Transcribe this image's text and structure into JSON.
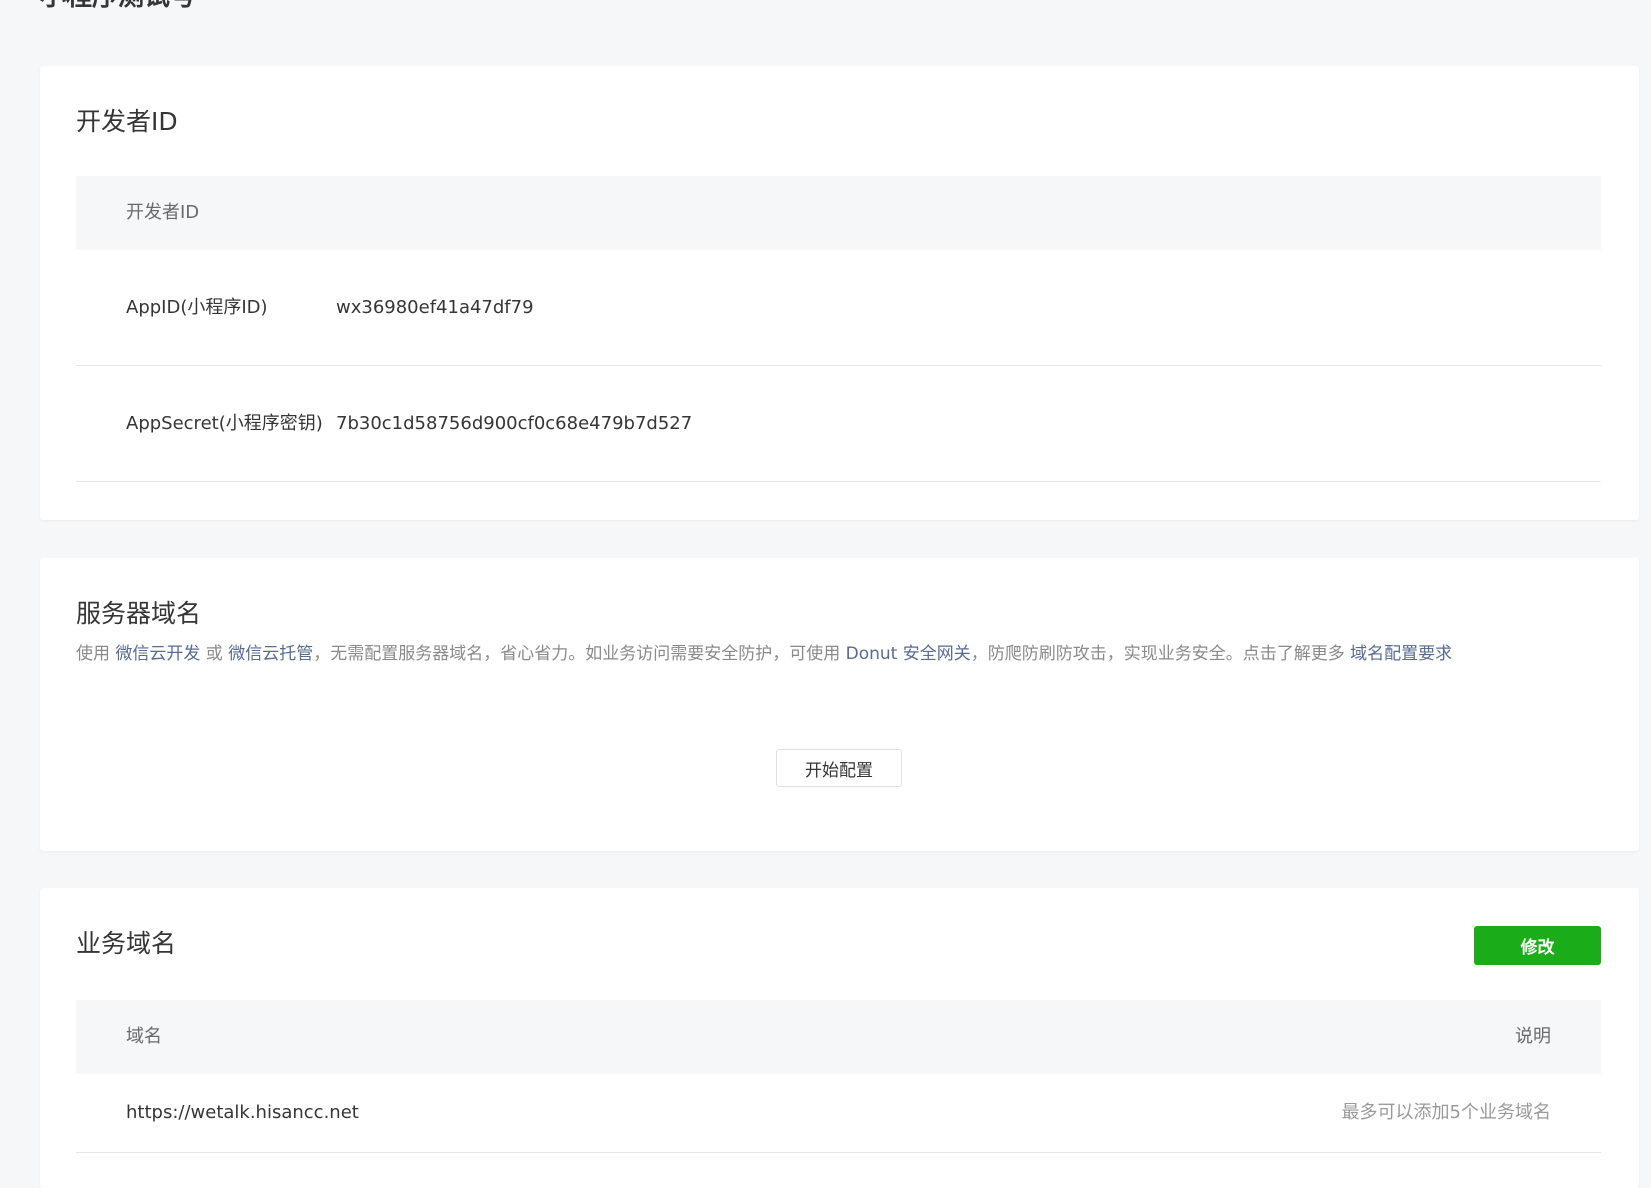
{
  "page": {
    "title": "小程序测试号"
  },
  "developer_id": {
    "title": "开发者ID",
    "table_header": "开发者ID",
    "rows": [
      {
        "label": "AppID(小程序ID)",
        "value": "wx36980ef41a47df79"
      },
      {
        "label": "AppSecret(小程序密钥)",
        "value": "7b30c1d58756d900cf0c68e479b7d527"
      }
    ]
  },
  "server_domain": {
    "title": "服务器域名",
    "desc_prefix": "使用 ",
    "link_weixin_cloud_dev": "微信云开发",
    "desc_or": " 或 ",
    "link_weixin_cloud_host": "微信云托管",
    "desc_middle": "，无需配置服务器域名，省心省力。如业务访问需要安全防护，可使用 ",
    "link_donut": "Donut 安全网关",
    "desc_tail": "，防爬防刷防攻击，实现业务安全。点击了解更多 ",
    "link_domain_req": "域名配置要求",
    "start_button": "开始配置"
  },
  "business_domain": {
    "title": "业务域名",
    "modify_button": "修改",
    "columns": {
      "domain": "域名",
      "note": "说明"
    },
    "rows": [
      {
        "domain": "https://wetalk.hisancc.net",
        "note": "最多可以添加5个业务域名"
      }
    ]
  }
}
